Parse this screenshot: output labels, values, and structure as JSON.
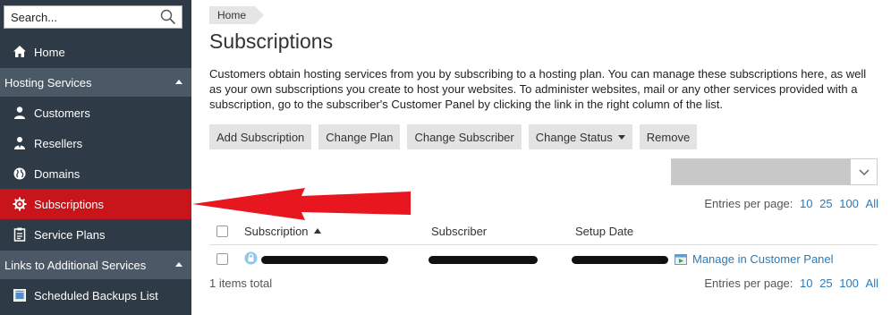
{
  "sidebar": {
    "search_placeholder": "Search...",
    "home": "Home",
    "hosting_section": "Hosting Services",
    "items": [
      {
        "label": "Customers",
        "icon": "user-icon"
      },
      {
        "label": "Resellers",
        "icon": "reseller-icon"
      },
      {
        "label": "Domains",
        "icon": "globe-icon"
      },
      {
        "label": "Subscriptions",
        "icon": "gear-icon"
      },
      {
        "label": "Service Plans",
        "icon": "plan-icon"
      }
    ],
    "links_section": "Links to Additional Services",
    "scheduled_backups": "Scheduled Backups List"
  },
  "main": {
    "breadcrumb": "Home",
    "title": "Subscriptions",
    "description": "Customers obtain hosting services from you by subscribing to a hosting plan. You can manage these subscriptions here, as well as your own subscriptions you create to host your websites. To administer websites, mail or any other services provided with a subscription, go to the subscriber's Customer Panel by clicking the link in the right column of the list.",
    "toolbar": {
      "add": "Add Subscription",
      "change_plan": "Change Plan",
      "change_subscriber": "Change Subscriber",
      "change_status": "Change Status",
      "remove": "Remove"
    },
    "entries_per_page": "Entries per page:",
    "page_options": [
      "10",
      "25",
      "100",
      "All"
    ],
    "columns": {
      "subscription": "Subscription",
      "subscriber": "Subscriber",
      "setup_date": "Setup Date"
    },
    "row": {
      "manage_link": "Manage in Customer Panel"
    },
    "total": "1 items total"
  },
  "colors": {
    "sidebar_bg": "#2e3a46",
    "section_bg": "#4b5966",
    "active_red": "#c8141b",
    "link_blue": "#2a7ab8",
    "annotation_arrow": "#e8161e"
  }
}
